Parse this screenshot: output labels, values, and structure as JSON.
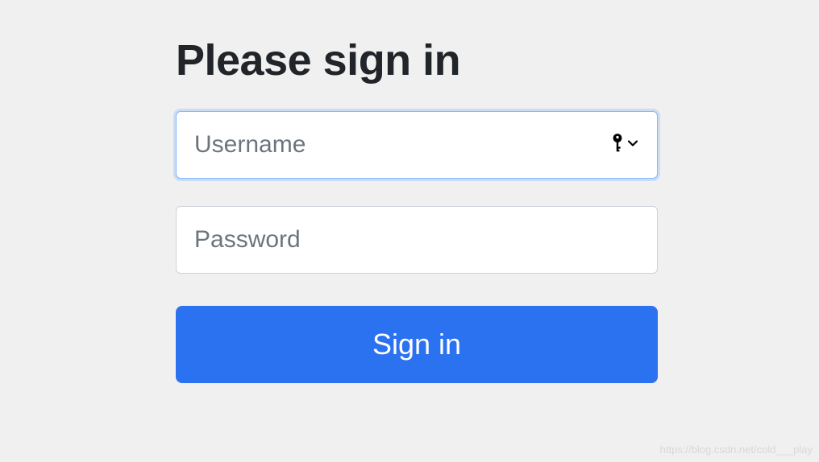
{
  "heading": "Please sign in",
  "form": {
    "username": {
      "placeholder": "Username",
      "value": ""
    },
    "password": {
      "placeholder": "Password",
      "value": ""
    },
    "submit_label": "Sign in"
  },
  "icons": {
    "autofill_key": "key-icon",
    "autofill_chevron": "chevron-down-icon"
  },
  "watermark": "https://blog.csdn.net/cold___play"
}
